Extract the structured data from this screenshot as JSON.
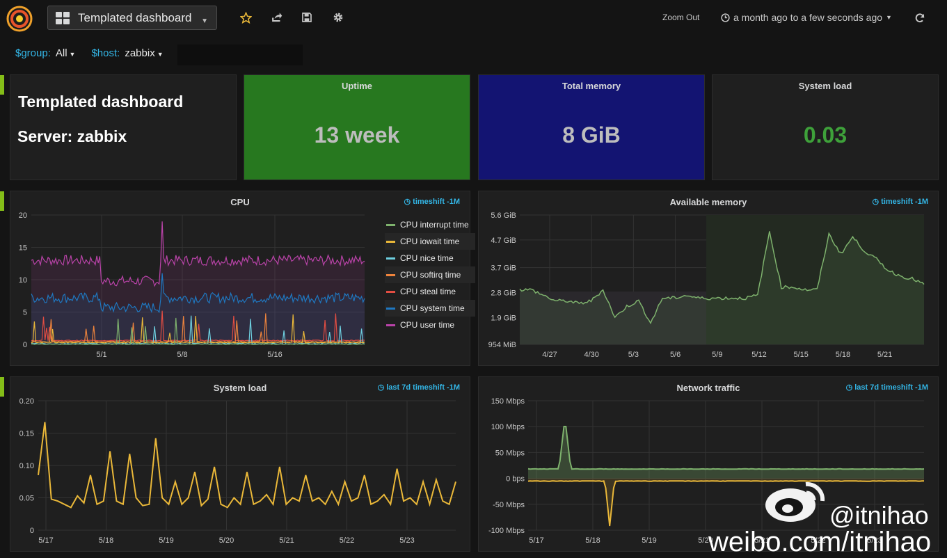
{
  "nav": {
    "dashboard_title": "Templated dashboard",
    "zoom_out": "Zoom Out",
    "time_range": "a month ago to a few seconds ago"
  },
  "variables": [
    {
      "label": "$group:",
      "value": "All"
    },
    {
      "label": "$host:",
      "value": "zabbix"
    }
  ],
  "text_panel": {
    "line1": "Templated dashboard",
    "line2": "Server: zabbix"
  },
  "stats": [
    {
      "title": "Uptime",
      "value": "13 week",
      "bg": "#27781f",
      "color": "#bdbdbd"
    },
    {
      "title": "Total memory",
      "value": "8 GiB",
      "bg": "#131472",
      "color": "#bdbdbd"
    },
    {
      "title": "System load",
      "value": "0.03",
      "bg": "#1f1f1f",
      "color": "#3ea13a"
    }
  ],
  "panels": {
    "cpu": {
      "title": "CPU",
      "tag": "timeshift -1M"
    },
    "memory": {
      "title": "Available memory",
      "tag": "timeshift -1M"
    },
    "load": {
      "title": "System load",
      "tag": "last 7d timeshift -1M"
    },
    "network": {
      "title": "Network traffic",
      "tag": "last 7d timeshift -1M"
    }
  },
  "colors": {
    "green": "#7eb26d",
    "yellow": "#eab839",
    "cyan": "#6ed0e0",
    "orange": "#ef843c",
    "red": "#e24d42",
    "blue": "#1f78c1",
    "purple": "#ba43a9"
  },
  "chart_data": [
    {
      "type": "line",
      "title": "CPU",
      "x_ticks": [
        "5/1",
        "5/8",
        "5/16"
      ],
      "y_ticks": [
        "20",
        "15",
        "10",
        "5",
        "0"
      ],
      "ylim": [
        0,
        20
      ],
      "legend_placement": "right",
      "series": [
        {
          "name": "CPU interrupt time",
          "color": "#7eb26d",
          "level": 0.05
        },
        {
          "name": "CPU iowait time",
          "color": "#eab839",
          "level": 0.3
        },
        {
          "name": "CPU nice time",
          "color": "#6ed0e0",
          "level": 0.1
        },
        {
          "name": "CPU softirq time",
          "color": "#ef843c",
          "level": 0.4
        },
        {
          "name": "CPU steal time",
          "color": "#e24d42",
          "level": 0.6
        },
        {
          "name": "CPU system time",
          "color": "#1f78c1",
          "level": 7.2
        },
        {
          "name": "CPU user time",
          "color": "#ba43a9",
          "level": 13.0
        }
      ]
    },
    {
      "type": "area",
      "title": "Available memory",
      "x_ticks": [
        "4/27",
        "4/30",
        "5/3",
        "5/6",
        "5/9",
        "5/12",
        "5/15",
        "5/18",
        "5/21"
      ],
      "y_ticks": [
        "5.6 GiB",
        "4.7 GiB",
        "3.7 GiB",
        "2.8 GiB",
        "1.9 GiB",
        "954 MiB"
      ],
      "series": [
        {
          "color": "#7eb26d",
          "values_gib": [
            2.9,
            2.9,
            2.7,
            2.5,
            2.5,
            2.4,
            2.5,
            2.9,
            1.9,
            2.3,
            2.5,
            1.7,
            2.6,
            2.6,
            2.7,
            2.6,
            2.6,
            2.6,
            2.6,
            2.6,
            2.7,
            5.0,
            3.0,
            3.0,
            2.9,
            2.9,
            4.9,
            4.2,
            4.8,
            4.3,
            4.0,
            3.6,
            3.4,
            3.3,
            3.1
          ]
        }
      ]
    },
    {
      "type": "line",
      "title": "System load",
      "x_ticks": [
        "5/17",
        "5/18",
        "5/19",
        "5/20",
        "5/21",
        "5/22",
        "5/23"
      ],
      "y_ticks": [
        "0.20",
        "0.15",
        "0.10",
        "0.05",
        "0"
      ],
      "ylim": [
        0,
        0.2
      ],
      "series": [
        {
          "color": "#eab839",
          "values": [
            0.085,
            0.167,
            0.048,
            0.045,
            0.04,
            0.035,
            0.053,
            0.042,
            0.085,
            0.04,
            0.045,
            0.122,
            0.045,
            0.04,
            0.118,
            0.05,
            0.038,
            0.04,
            0.142,
            0.05,
            0.04,
            0.075,
            0.04,
            0.05,
            0.09,
            0.038,
            0.048,
            0.098,
            0.04,
            0.035,
            0.05,
            0.04,
            0.09,
            0.04,
            0.045,
            0.055,
            0.04,
            0.098,
            0.04,
            0.05,
            0.045,
            0.085,
            0.045,
            0.05,
            0.04,
            0.06,
            0.04,
            0.075,
            0.045,
            0.05,
            0.085,
            0.04,
            0.045,
            0.055,
            0.04,
            0.095,
            0.045,
            0.05,
            0.04,
            0.075,
            0.04,
            0.078,
            0.045,
            0.04,
            0.075
          ]
        }
      ]
    },
    {
      "type": "area",
      "title": "Network traffic",
      "x_ticks": [
        "5/17",
        "5/18",
        "5/19",
        "5/20",
        "5/21",
        "5/22",
        "5/23"
      ],
      "y_ticks": [
        "150 Mbps",
        "100 Mbps",
        "50 Mbps",
        "0 bps",
        "-50 Mbps",
        "-100 Mbps"
      ],
      "ylim": [
        -100,
        150
      ],
      "series": [
        {
          "color": "#7eb26d",
          "baseline_mbps": 18,
          "spike_mbps": 117
        },
        {
          "color": "#eab839",
          "baseline_mbps": -5,
          "spike_mbps": -92
        }
      ]
    }
  ],
  "watermark": {
    "handle": "@itnihao",
    "url": "weibo.com/itnihao"
  }
}
